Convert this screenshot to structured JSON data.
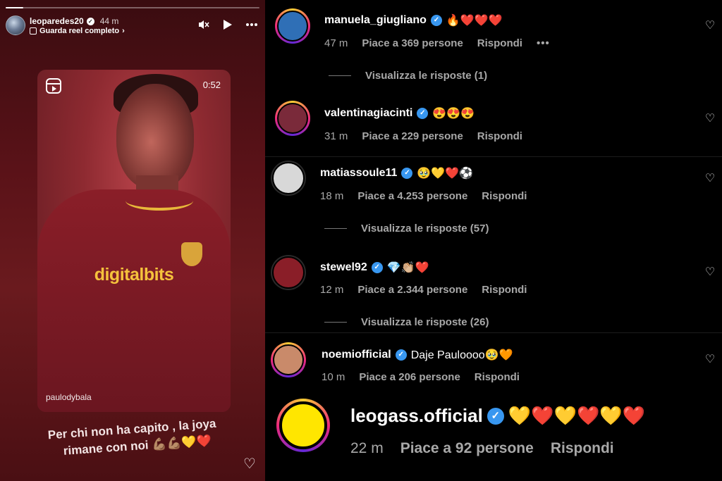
{
  "story": {
    "progress_fraction": 0.07,
    "username": "leoparedes20",
    "time": "44 m",
    "subtitle": "Guarda reel completo",
    "reel": {
      "duration": "0:52",
      "sponsor": "digitalbits",
      "author": "paulodybala"
    },
    "caption_line1": "Per chi non ha capito , la joya",
    "caption_line2": "rimane  con noi 💪🏽💪🏽💛❤️"
  },
  "comments": [
    {
      "username": "manuela_giugliano",
      "text": "🔥❤️❤️❤️",
      "time": "47 m",
      "likes": "Piace a 369 persone",
      "reply": "Rispondi",
      "more": "•••",
      "avatar_color": "#2f6fb6",
      "replies_label": "Visualizza le risposte (1)"
    },
    {
      "username": "valentinagiacinti",
      "text": "😍😍😍",
      "time": "31 m",
      "likes": "Piace a 229 persone",
      "reply": "Rispondi",
      "avatar_color": "#7a2a3a"
    },
    {
      "username": "matiassoule11",
      "text": "🥹💛❤️⚽",
      "time": "18 m",
      "likes": "Piace a 4.253 persone",
      "reply": "Rispondi",
      "avatar_color": "#d8d8d8",
      "replies_label": "Visualizza le risposte (57)"
    },
    {
      "username": "stewel92",
      "text": "💎👏🏼❤️",
      "time": "12 m",
      "likes": "Piace a 2.344 persone",
      "reply": "Rispondi",
      "avatar_color": "#8a1e28",
      "replies_label": "Visualizza le risposte (26)"
    },
    {
      "username": "noemiofficial",
      "text": "Daje Pauloooo🥹🧡",
      "time": "10 m",
      "likes": "Piace a 206 persone",
      "reply": "Rispondi",
      "avatar_color": "#c98a6a"
    },
    {
      "username": "leogass.official",
      "text": "💛❤️💛❤️💛❤️",
      "time": "22 m",
      "likes": "Piace a 92 persone",
      "reply": "Rispondi",
      "avatar_color": "#ffe600"
    }
  ],
  "colors": {
    "verified_badge": "#3897f0",
    "muted_text": "#a8a8a8",
    "story_bg": "#5a1218",
    "sponsor_yellow": "#f5c23c"
  },
  "icons": {
    "mute": "speaker-muted-icon",
    "play": "play-icon",
    "more": "more-horizontal-icon",
    "heart": "heart-outline-icon",
    "verified": "verified-badge-icon"
  }
}
